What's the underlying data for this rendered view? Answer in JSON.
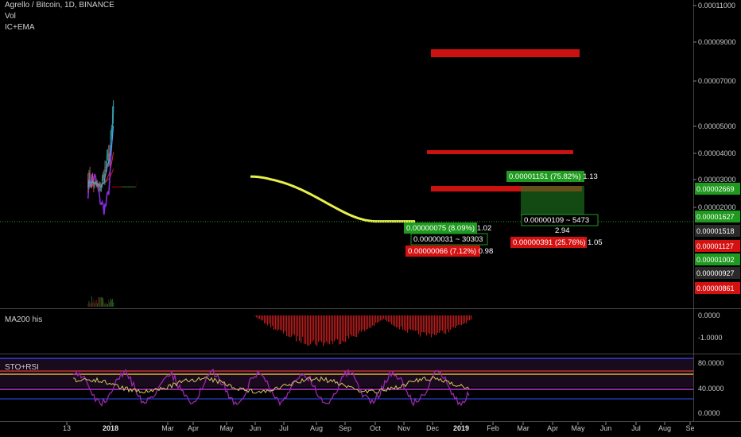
{
  "header": {
    "symbol": "Agrello / Bitcoin, 1D, BINANCE",
    "vol": "Vol",
    "indicator": "IC+EMA",
    "pane2_title": "MA200 his",
    "pane3_title": "STO+RSI"
  },
  "colors": {
    "background": "#000000",
    "candle_up": "#26a69a",
    "candle_down": "#ef5350",
    "purple_line": "#8a2be2",
    "ema_yellow": "#e8f04a",
    "cloud_red": "#8b0000",
    "cloud_green": "#1b5e20",
    "zone_red": "#cc1111",
    "zone_green": "#1f7a1f"
  },
  "chart_data": [
    {
      "type": "candlestick",
      "title": "Agrello / Bitcoin, 1D, BINANCE",
      "y_scale": "log",
      "ylim": [
        7.5e-06,
        1.15e-05
      ],
      "x_ticks": [
        "13",
        "2018",
        "Mar",
        "Apr",
        "May",
        "Jun",
        "Jul",
        "Aug",
        "Sep",
        "Oct",
        "Nov",
        "Dec",
        "2019",
        "Feb",
        "Mar",
        "Apr",
        "May",
        "Jun",
        "Jul",
        "Aug",
        "Se"
      ],
      "y_ticks": [
        "0.00011000",
        "0.00009000",
        "0.00007000",
        "0.00005000",
        "0.00004000",
        "0.00003000",
        "0.00002000"
      ],
      "price_path_approx": [
        {
          "x": "Dec-08",
          "close": 3e-05
        },
        {
          "x": "Dec-20",
          "close": 2.6e-05
        },
        {
          "x": "Jan-01",
          "close": 4.2e-05
        },
        {
          "x": "Jan-08",
          "close": 9.2e-05
        },
        {
          "x": "Jan-20",
          "close": 5.5e-05
        },
        {
          "x": "Feb-05",
          "close": 3e-05
        },
        {
          "x": "Mar-01",
          "close": 3.8e-05
        },
        {
          "x": "Apr-01",
          "close": 2.6e-05
        },
        {
          "x": "May-01",
          "close": 3.3e-05
        },
        {
          "x": "Jun-01",
          "close": 2.2e-05
        },
        {
          "x": "Jul-01",
          "close": 1.6e-05
        },
        {
          "x": "Aug-01",
          "close": 1.2e-05
        },
        {
          "x": "Sep-01",
          "close": 1e-05
        },
        {
          "x": "Oct-01",
          "close": 1.4e-05
        },
        {
          "x": "Nov-01",
          "close": 1.6e-05
        },
        {
          "x": "Dec-01",
          "close": 1.5e-05
        },
        {
          "x": "Jan-05",
          "close": 1.63e-05
        }
      ],
      "price_labels": [
        {
          "text": "0.00002669",
          "bg": "#1f9a1f"
        },
        {
          "text": "0.00001627",
          "bg": "#1f9a1f"
        },
        {
          "text": "0.00001518",
          "bg": "#2a2a2a"
        },
        {
          "text": "0.00001127",
          "bg": "#d41111"
        },
        {
          "text": "0.00001002",
          "bg": "#1f9a1f"
        },
        {
          "text": "0.00000927",
          "bg": "#2a2a2a"
        },
        {
          "text": "0.00000861",
          "bg": "#d41111"
        }
      ],
      "annotations": [
        {
          "text": "0.00001151 (75.82%) 1.13",
          "bg": "#1f9a1f"
        },
        {
          "text": "0.00000109 ~ 5473",
          "bg": "#000000"
        },
        {
          "text": "2.94",
          "bg": "#000000"
        },
        {
          "text": "0.00000391 (25.76%) 1.05",
          "bg": "#d41111"
        },
        {
          "text": "0.00000075 (8.09%) 1.02",
          "bg": "#1f9a1f"
        },
        {
          "text": "0.00000031 ~ 30303",
          "bg": "#000000"
        },
        {
          "text": "0.00000066 (7.12%) 0.98",
          "bg": "#d41111"
        }
      ]
    },
    {
      "type": "bar",
      "title": "MA200 his",
      "y_ticks": [
        "0.0000",
        "-1.0000"
      ],
      "ylim": [
        -1.3,
        0.2
      ]
    },
    {
      "type": "line",
      "title": "STO+RSI",
      "y_ticks": [
        "80.0000",
        "40.0000",
        "0.0000"
      ],
      "ylim": [
        0,
        100
      ]
    }
  ]
}
